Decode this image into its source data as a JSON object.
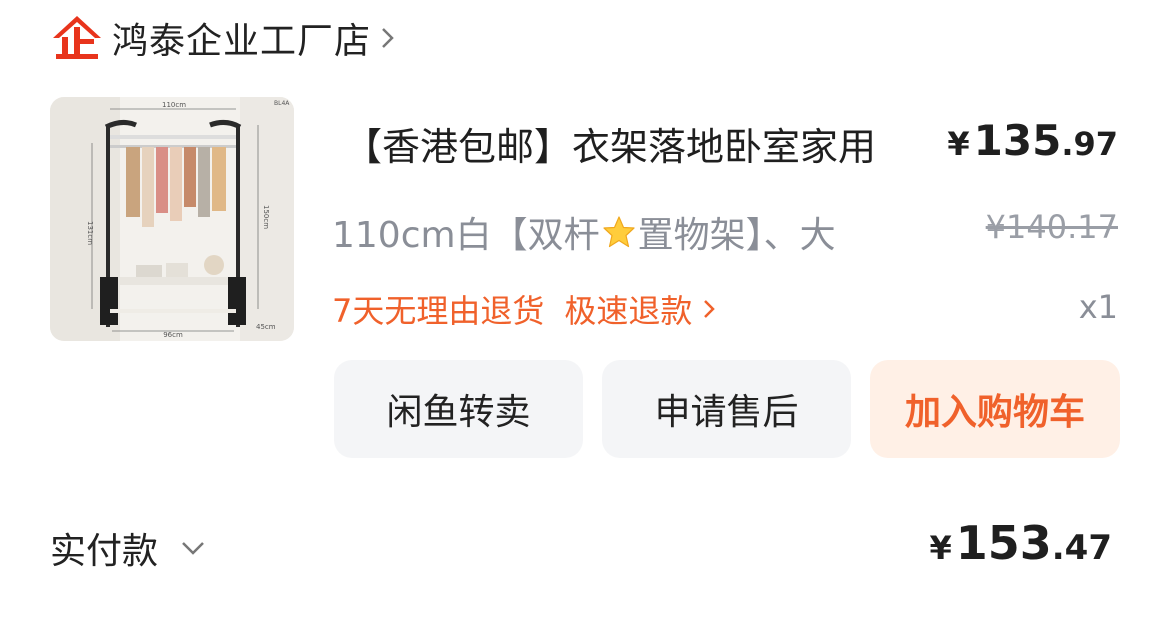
{
  "shop": {
    "name": "鸿泰企业工厂店",
    "logo_icon": "enterprise-logo-icon",
    "logo_color": "#e8341c"
  },
  "item": {
    "title": "【香港包邮】衣架落地卧室家用",
    "price_currency": "¥",
    "price_integer": "135",
    "price_decimal": ".97",
    "spec_before": "110cm白【双杆",
    "spec_icon": "star-emoji-icon",
    "spec_after": "置物架】、大",
    "original_price": "¥140.17",
    "promo_return": "7天无理由退货",
    "promo_refund": "极速退款",
    "quantity": "x1",
    "image_labels": {
      "top": "110cm",
      "side": "150cm",
      "left": "131cm",
      "bottom": "96cm",
      "depth": "45cm",
      "corner": "BL4A"
    }
  },
  "buttons": {
    "resell": "闲鱼转卖",
    "after_sale": "申请售后",
    "add_cart": "加入购物车"
  },
  "payment": {
    "label": "实付款",
    "currency": "¥",
    "integer": "153",
    "decimal": ".47"
  },
  "colors": {
    "accent": "#f0612b",
    "muted": "#8a8e97",
    "button_grey": "#f4f5f7",
    "button_orange_bg": "#fff0e6"
  }
}
